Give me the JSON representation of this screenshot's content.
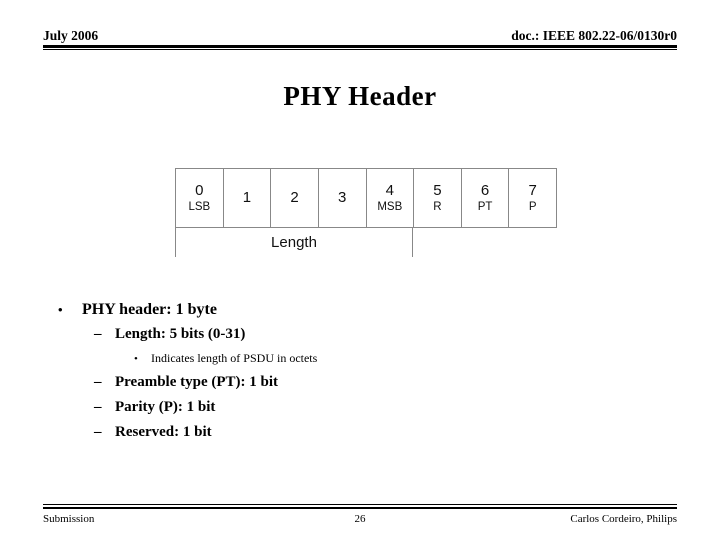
{
  "header": {
    "date": "July 2006",
    "doc_reference": "doc.: IEEE 802.22-06/0130r0"
  },
  "title": "PHY Header",
  "diagram": {
    "name": "phy-header-bit-map",
    "bits": [
      {
        "index": "0",
        "sub": "LSB"
      },
      {
        "index": "1",
        "sub": ""
      },
      {
        "index": "2",
        "sub": ""
      },
      {
        "index": "3",
        "sub": ""
      },
      {
        "index": "4",
        "sub": "MSB"
      },
      {
        "index": "5",
        "sub": "R"
      },
      {
        "index": "6",
        "sub": "PT"
      },
      {
        "index": "7",
        "sub": "P"
      }
    ],
    "span_label": "Length"
  },
  "bullets": {
    "marker_level1": "•",
    "marker_level2": "–",
    "marker_level3": "•",
    "items": [
      {
        "level": 1,
        "text": "PHY header: 1 byte"
      },
      {
        "level": 2,
        "text": "Length: 5 bits (0-31)"
      },
      {
        "level": 3,
        "text": "Indicates length of PSDU in octets"
      },
      {
        "level": 2,
        "text": "Preamble type (PT): 1 bit"
      },
      {
        "level": 2,
        "text": "Parity (P): 1 bit"
      },
      {
        "level": 2,
        "text": "Reserved: 1 bit"
      }
    ]
  },
  "footer": {
    "left": "Submission",
    "page_number": "26",
    "right": "Carlos Cordeiro, Philips"
  },
  "colors": {
    "text": "#000000",
    "diagram_border": "#888888",
    "diagram_text": "#111111",
    "background": "#ffffff"
  }
}
